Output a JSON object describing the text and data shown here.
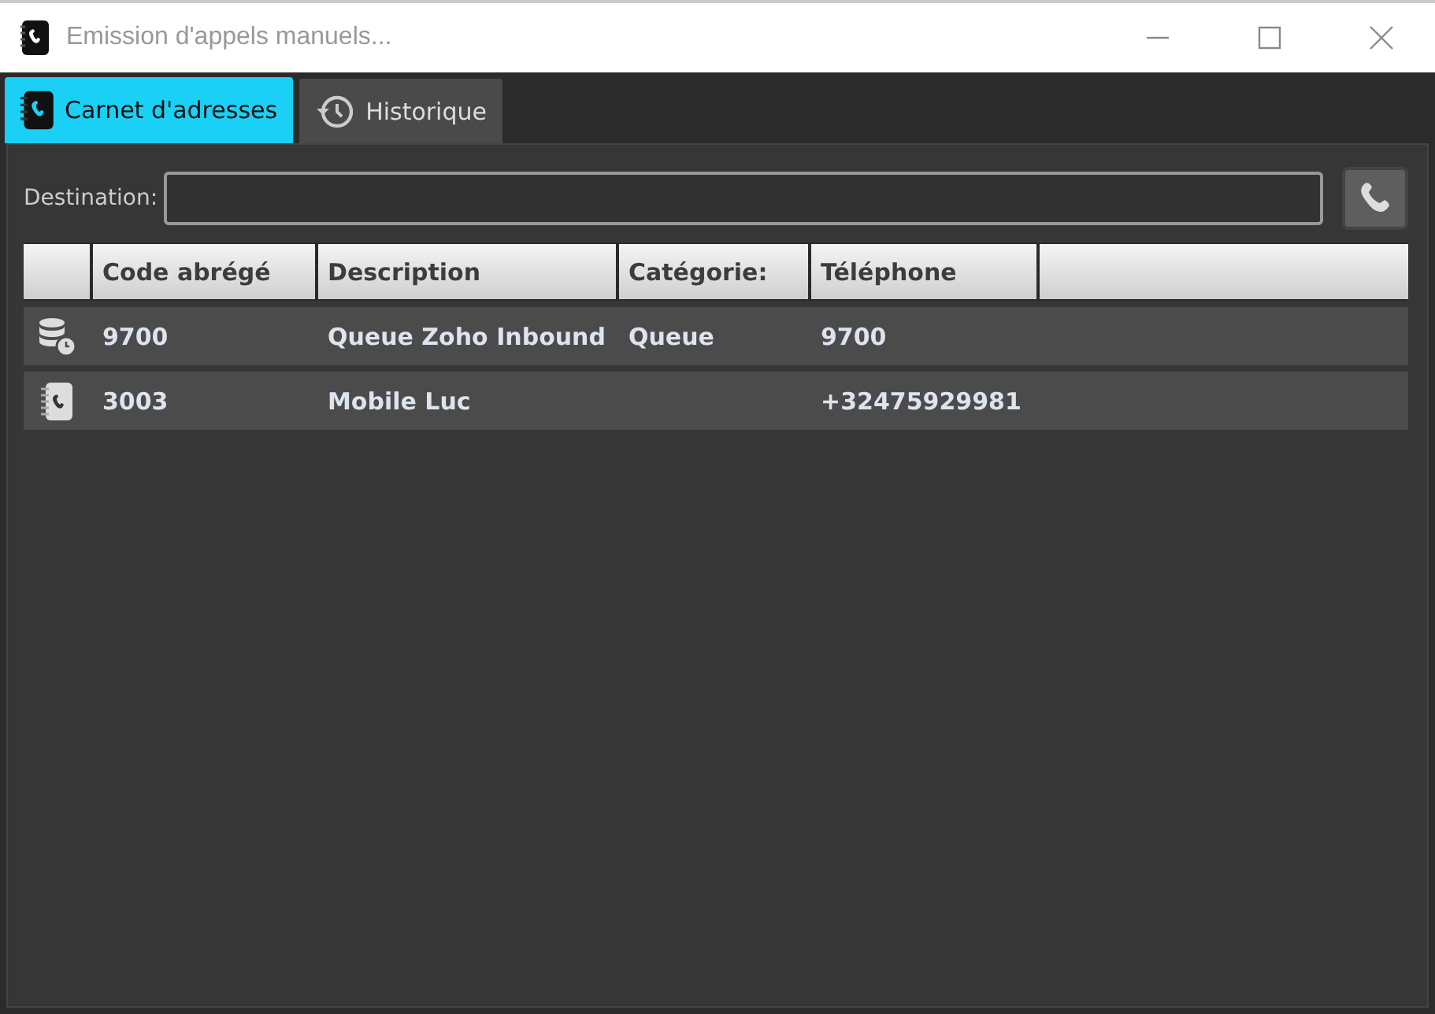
{
  "window": {
    "title": "Emission d'appels manuels..."
  },
  "tabs": [
    {
      "label": "Carnet d'adresses",
      "kind": "addressbook",
      "selected": true
    },
    {
      "label": "Historique",
      "kind": "history",
      "selected": false
    }
  ],
  "destination": {
    "label": "Destination:"
  },
  "table": {
    "columns": [
      "Code abrégé",
      "Description",
      "Catégorie:",
      "Téléphone"
    ],
    "rows": [
      {
        "kind": "queue",
        "cells": [
          "9700",
          "Queue Zoho Inbound",
          "Queue",
          "9700"
        ]
      },
      {
        "kind": "contact",
        "cells": [
          "3003",
          "Mobile Luc",
          "",
          "+32475929981"
        ]
      }
    ]
  }
}
